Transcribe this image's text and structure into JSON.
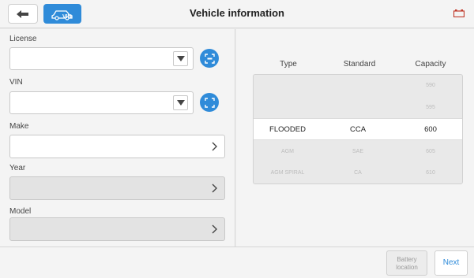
{
  "header": {
    "title": "Vehicle information",
    "vin_button_label": "VIN",
    "accent_color": "#2f8bd9"
  },
  "form": {
    "license": {
      "label": "License",
      "value": ""
    },
    "vin": {
      "label": "VIN",
      "value": ""
    },
    "make": {
      "label": "Make",
      "value": ""
    },
    "year": {
      "label": "Year",
      "value": ""
    },
    "model": {
      "label": "Model",
      "value": ""
    }
  },
  "battery_table": {
    "columns": [
      "Type",
      "Standard",
      "Capacity"
    ],
    "rows": [
      {
        "type": "",
        "standard": "",
        "capacity": "590"
      },
      {
        "type": "",
        "standard": "",
        "capacity": "595"
      },
      {
        "type": "FLOODED",
        "standard": "CCA",
        "capacity": "600",
        "selected": true
      },
      {
        "type": "AGM",
        "standard": "SAE",
        "capacity": "605"
      },
      {
        "type": "AGM SPIRAL",
        "standard": "CA",
        "capacity": "610"
      }
    ]
  },
  "footer": {
    "battery_location_label": "Battery location",
    "next_label": "Next"
  },
  "icons": {
    "back": "back-arrow-icon",
    "vin": "car-vin-icon",
    "battery": "battery-icon",
    "scan": "scan-icon",
    "dropdown": "dropdown-triangle-icon",
    "chevron": "chevron-right-icon"
  }
}
